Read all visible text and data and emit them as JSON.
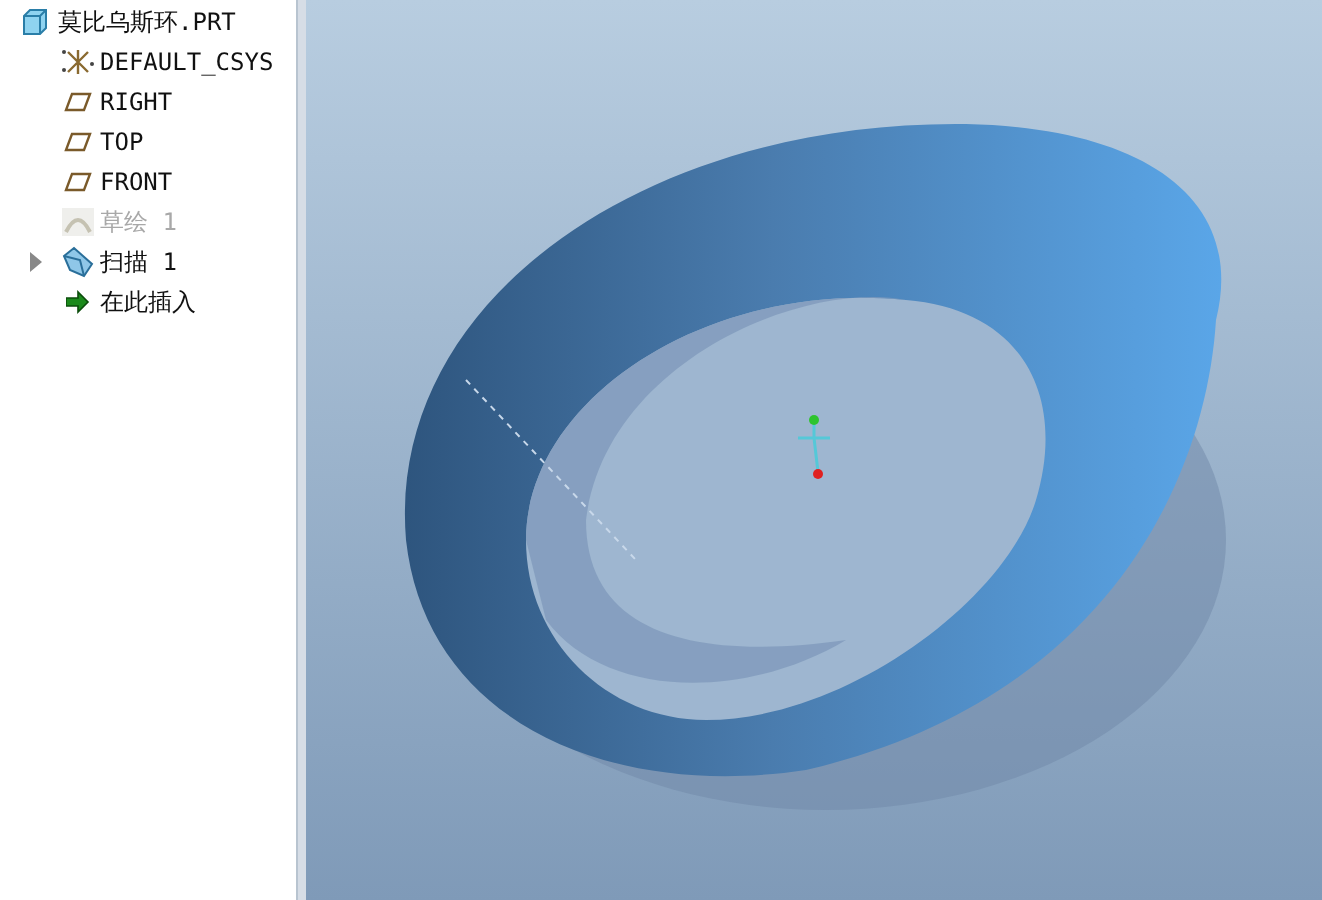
{
  "model_tree": {
    "root": {
      "label": "莫比乌斯环.PRT",
      "children": [
        {
          "kind": "csys",
          "label": "DEFAULT_CSYS",
          "disabled": false
        },
        {
          "kind": "plane",
          "label": "RIGHT",
          "disabled": false
        },
        {
          "kind": "plane",
          "label": "TOP",
          "disabled": false
        },
        {
          "kind": "plane",
          "label": "FRONT",
          "disabled": false
        },
        {
          "kind": "sketch",
          "label": "草绘 1",
          "disabled": true
        },
        {
          "kind": "sweep",
          "label": "扫描 1",
          "disabled": false,
          "expanded": false
        },
        {
          "kind": "insert",
          "label": "在此插入",
          "disabled": false
        }
      ]
    }
  }
}
